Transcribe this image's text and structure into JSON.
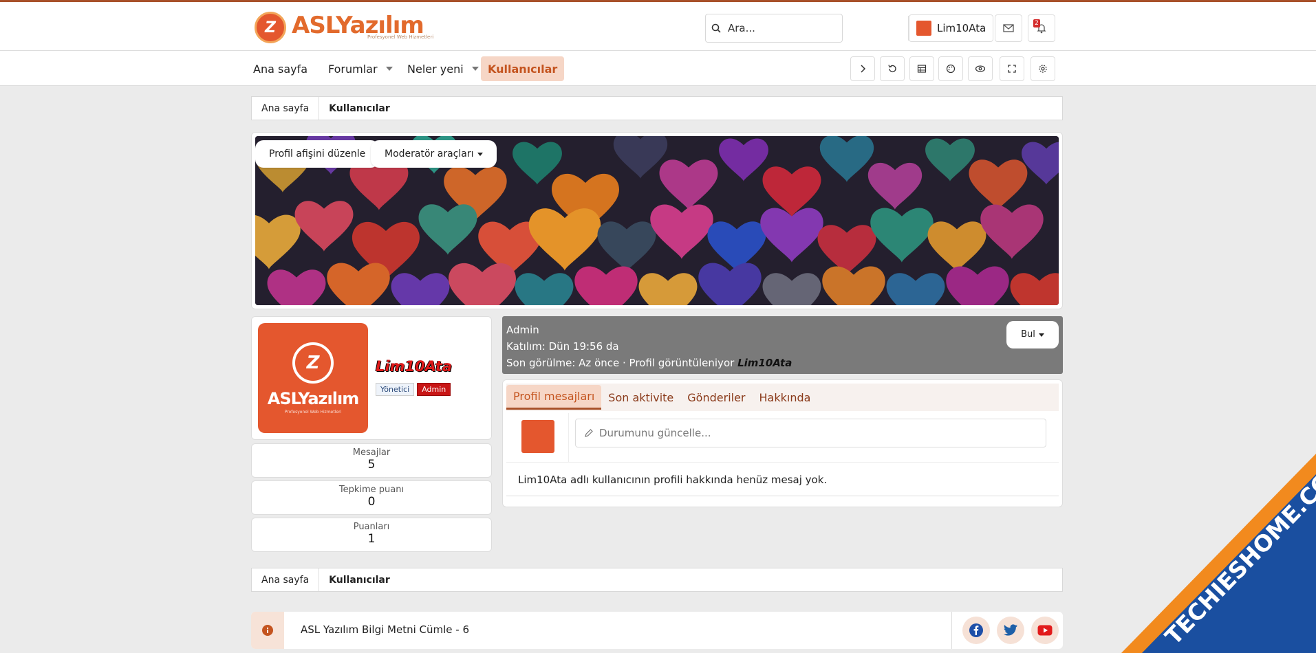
{
  "brand": {
    "name": "ASLYazılım",
    "tagline": "Profesyonel Web Hizmetleri"
  },
  "header": {
    "search_placeholder": "Ara...",
    "user_name": "Lim10Ata",
    "notification_count": "2"
  },
  "nav": {
    "items": [
      {
        "label": "Ana sayfa",
        "dropdown": false
      },
      {
        "label": "Forumlar",
        "dropdown": true
      },
      {
        "label": "Neler yeni",
        "dropdown": true
      },
      {
        "label": "Kullanıcılar",
        "dropdown": false,
        "active": true
      }
    ],
    "tools": [
      "chevron-right-icon",
      "undo-icon",
      "table-icon",
      "palette-icon",
      "eye-icon",
      "fullscreen-icon",
      "settings-icon"
    ]
  },
  "breadcrumb": {
    "home": "Ana sayfa",
    "current": "Kullanıcılar"
  },
  "cover": {
    "edit_label": "Profil afişini düzenle",
    "moderator_label": "Moderatör araçları"
  },
  "profile": {
    "username": "Lim10Ata",
    "roles": [
      "Yönetici",
      "Admin"
    ],
    "title": "Admin",
    "joined": "Katılım: Dün 19:56 da",
    "last_seen_prefix": "Son görülme: Az önce · Profil görüntüleniyor ",
    "last_seen_user": "Lim10Ata",
    "find_label": "Bul"
  },
  "stats": [
    {
      "label": "Mesajlar",
      "value": "5"
    },
    {
      "label": "Tepkime puanı",
      "value": "0"
    },
    {
      "label": "Puanları",
      "value": "1"
    }
  ],
  "tabs": [
    "Profil mesajları",
    "Son aktivite",
    "Gönderiler",
    "Hakkında"
  ],
  "status_placeholder": "Durumunu güncelle...",
  "empty_message": "Lim10Ata adlı kullanıcının profili hakkında henüz mesaj yok.",
  "notice": {
    "text": "ASL Yazılım Bilgi Metni Cümle - 6"
  },
  "social": [
    "facebook-icon",
    "twitter-icon",
    "youtube-icon"
  ],
  "watermark": {
    "text": "TECHIESHOME.COM"
  },
  "colors": {
    "accent": "#c4541f",
    "accent_light": "#f6d6c6",
    "info_bar": "#7a7a7a",
    "brand_orange": "#e4572e"
  }
}
